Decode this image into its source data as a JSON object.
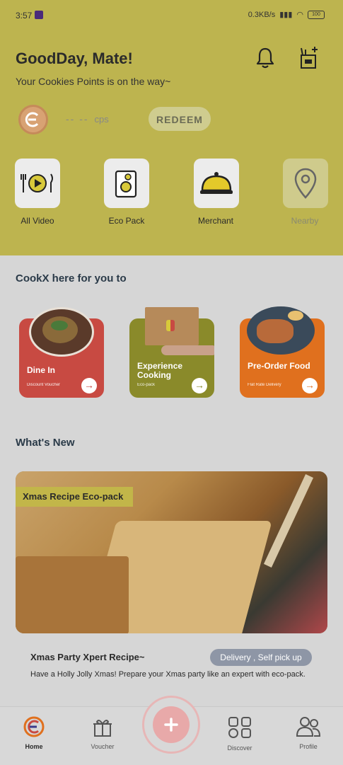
{
  "status": {
    "time": "3:57",
    "speed": "0.3KB/s",
    "battery": "100"
  },
  "header": {
    "greeting": "GoodDay, Mate!",
    "subtitle": "Your Cookies Points is on the way~",
    "points_value": "-- --",
    "points_unit": "cps",
    "redeem_label": "REDEEM"
  },
  "quick_actions": [
    {
      "label": "All Video"
    },
    {
      "label": "Eco Pack"
    },
    {
      "label": "Merchant"
    },
    {
      "label": "Nearby"
    }
  ],
  "cookx": {
    "title": "CookX here for you to",
    "cards": [
      {
        "title": "Dine In",
        "subtitle": "Discount Voucher",
        "color": "#c84a42"
      },
      {
        "title": "Experience Cooking",
        "subtitle": "Eco-pack",
        "color": "#8a8a2a"
      },
      {
        "title": "Pre-Order Food",
        "subtitle": "Flat Rate Delivery",
        "color": "#e0701e"
      }
    ]
  },
  "whats_new": {
    "title": "What's New",
    "banner_tag": "Xmas Recipe Eco-pack",
    "post_title": "Xmas Party Xpert Recipe~",
    "post_pill": "Delivery , Self pick up",
    "post_desc": "Have a Holly Jolly Xmas! Prepare your Xmas party like an expert with eco-pack."
  },
  "nav": {
    "home": "Home",
    "voucher": "Voucher",
    "discover": "Discover",
    "profile": "Profile"
  },
  "colors": {
    "header_bg": "#bdb44f",
    "accent": "#e0701e",
    "fab": "#e8a9a9"
  }
}
